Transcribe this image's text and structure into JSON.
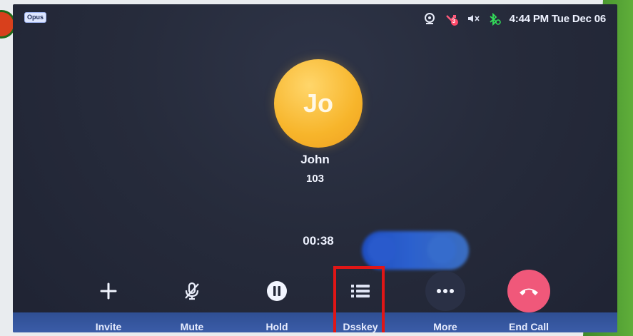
{
  "status_bar": {
    "codec_badge": "Opus",
    "icons": [
      "webcam-icon",
      "missed-call-icon",
      "speaker-muted-icon",
      "bluetooth-icon"
    ],
    "missed_calls_count": "3",
    "datetime": "4:44 PM Tue Dec 06"
  },
  "caller": {
    "initials": "Jo",
    "name": "John",
    "number": "103"
  },
  "call": {
    "duration": "00:38"
  },
  "actions": [
    {
      "label": "Invite",
      "icon": "plus-icon"
    },
    {
      "label": "Mute",
      "icon": "mic-off-icon"
    },
    {
      "label": "Hold",
      "icon": "pause-icon"
    },
    {
      "label": "Dsskey",
      "icon": "list-icon"
    },
    {
      "label": "More",
      "icon": "more-icon"
    },
    {
      "label": "End Call",
      "icon": "hangup-icon"
    }
  ],
  "colors": {
    "background": "#262b3b",
    "avatar": "#f7b52b",
    "end_call": "#f0587a",
    "highlight": "#e01616"
  }
}
